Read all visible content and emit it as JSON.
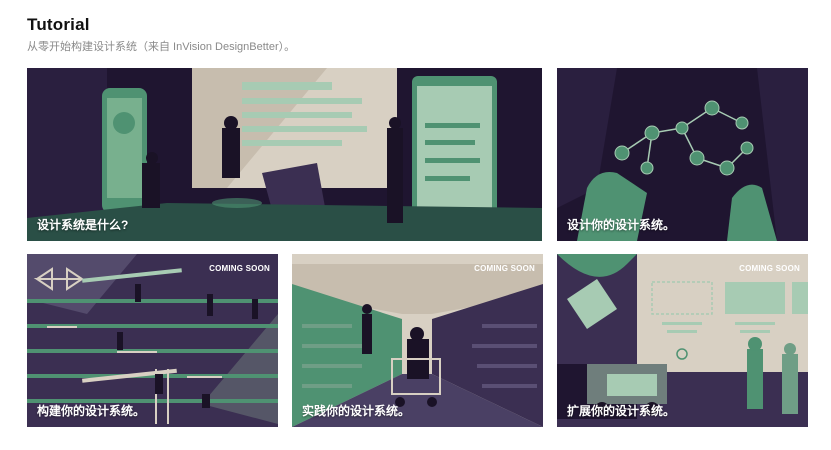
{
  "header": {
    "title": "Tutorial",
    "subtitle": "从零开始构建设计系统（来自 InVision DesignBetter）。"
  },
  "colors": {
    "deep_purple": "#1f1530",
    "purple": "#3b2f52",
    "green": "#4f9272",
    "mint": "#a7cbb3",
    "beige": "#d8d0c3"
  },
  "cards": [
    {
      "title": "设计系统是什么?",
      "badge": ""
    },
    {
      "title": "设计你的设计系统。",
      "badge": ""
    },
    {
      "title": "构建你的设计系统。",
      "badge": "COMING SOON"
    },
    {
      "title": "实践你的设计系统。",
      "badge": "COMING SOON"
    },
    {
      "title": "扩展你的设计系统。",
      "badge": "COMING SOON"
    }
  ]
}
